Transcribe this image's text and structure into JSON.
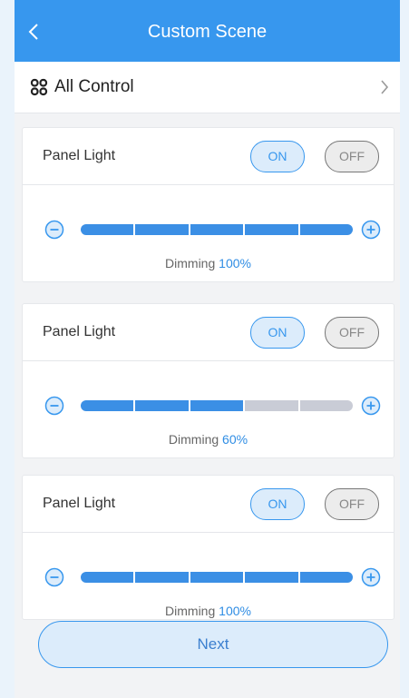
{
  "header": {
    "title": "Custom Scene"
  },
  "all_control": {
    "label": "All Control"
  },
  "cards": [
    {
      "name": "Panel Light",
      "on_label": "ON",
      "off_label": "OFF",
      "dimming_label": "Dimming",
      "dimming_value": "100%",
      "level": 1.0
    },
    {
      "name": "Panel Light",
      "on_label": "ON",
      "off_label": "OFF",
      "dimming_label": "Dimming",
      "dimming_value": "60%",
      "level": 0.6
    },
    {
      "name": "Panel Light",
      "on_label": "ON",
      "off_label": "OFF",
      "dimming_label": "Dimming",
      "dimming_value": "100%",
      "level": 1.0
    }
  ],
  "footer": {
    "next_label": "Next"
  },
  "colors": {
    "primary": "#3797ee",
    "bar_filled": "#3b8fe5",
    "bar_empty": "#c9ccd6",
    "background": "#eaf3fb"
  }
}
